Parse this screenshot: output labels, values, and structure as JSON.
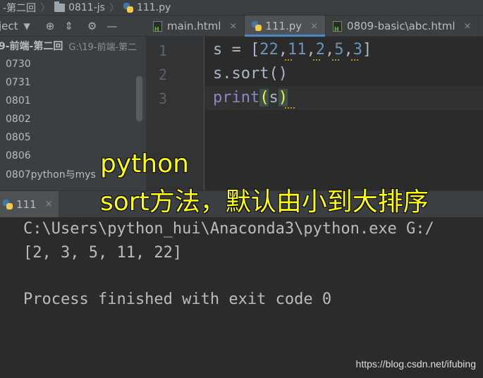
{
  "breadcrumb": {
    "items": [
      "-第二回",
      "0811-js",
      "111.py"
    ]
  },
  "project_toolbar": {
    "label": "ject",
    "icons": [
      "chevron-down-icon",
      "target-icon",
      "collapse-icon",
      "gear-icon",
      "minimize-icon"
    ]
  },
  "tabs": [
    {
      "label": "main.html",
      "icon": "html-file-icon",
      "active": false
    },
    {
      "label": "111.py",
      "icon": "python-file-icon",
      "active": true
    },
    {
      "label": "0809-basic\\abc.html",
      "icon": "html-file-icon",
      "active": false
    }
  ],
  "tree": {
    "root_name": "9-前端-第二回",
    "root_path": "G:\\19-前端-第二",
    "items": [
      "0730",
      "0731",
      "0801",
      "0802",
      "0805",
      "0806",
      "0807python与mys"
    ]
  },
  "editor": {
    "line_numbers": [
      "1",
      "2",
      "3"
    ],
    "line1": {
      "var": "s",
      "op": " = [",
      "nums": [
        "22",
        "11",
        "2",
        "5",
        "3"
      ],
      "close": "]"
    },
    "line2": "s.sort()",
    "line3": {
      "fn": "print",
      "open": "(",
      "arg": "s",
      "close": ")"
    }
  },
  "run": {
    "tab_label": "111",
    "console": [
      "C:\\Users\\python_hui\\Anaconda3\\python.exe G:/",
      "[2, 3, 5, 11, 22]",
      "",
      "Process finished with exit code 0"
    ]
  },
  "overlay": {
    "line1": "python",
    "line2": "sort方法，默认由小到大排序"
  },
  "watermark": "https://blog.csdn.net/ifubing",
  "colors": {
    "editor_bg": "#2b2b2b",
    "panel_bg": "#3c3f41",
    "number": "#6897bb",
    "builtin": "#8888c6",
    "overlay_text": "#ffff00"
  }
}
